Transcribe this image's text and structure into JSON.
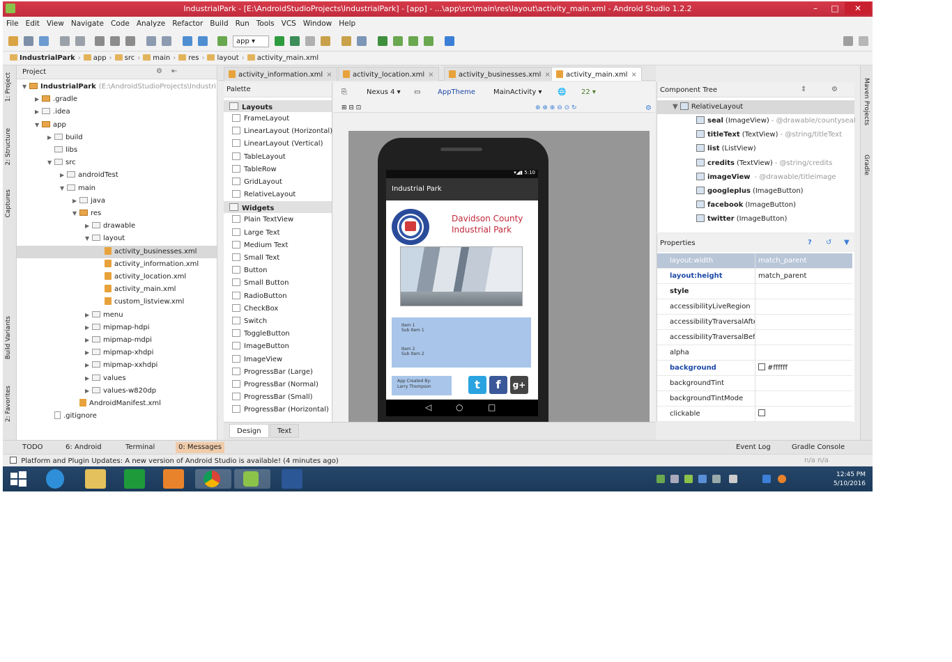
{
  "window": {
    "title": "IndustrialPark - [E:\\AndroidStudioProjects\\IndustrialPark] - [app] - ...\\app\\src\\main\\res\\layout\\activity_main.xml - Android Studio 1.2.2",
    "minimize": "–",
    "maximize": "□",
    "close": "✕"
  },
  "menu": [
    "File",
    "Edit",
    "View",
    "Navigate",
    "Code",
    "Analyze",
    "Refactor",
    "Build",
    "Run",
    "Tools",
    "VCS",
    "Window",
    "Help"
  ],
  "toolbar": {
    "run_config": "app ▾"
  },
  "breadcrumb": [
    "IndustrialPark",
    "app",
    "src",
    "main",
    "res",
    "layout",
    "activity_main.xml"
  ],
  "left_strip": [
    "1: Project",
    "2: Structure",
    "Captures",
    "Build Variants",
    "2: Favorites"
  ],
  "right_strip": [
    "Maven Projects",
    "Gradle"
  ],
  "project": {
    "header": "Project",
    "tree": [
      {
        "label": "IndustrialPark",
        "extra": "(E:\\AndroidStudioProjects\\Industri",
        "kind": "folder-mod",
        "depth": 0,
        "arrow": "▼"
      },
      {
        "label": ".gradle",
        "kind": "folder-mod",
        "depth": 1,
        "arrow": "▶"
      },
      {
        "label": ".idea",
        "kind": "folder",
        "depth": 1,
        "arrow": "▶"
      },
      {
        "label": "app",
        "kind": "folder-mod",
        "depth": 1,
        "arrow": "▼"
      },
      {
        "label": "build",
        "kind": "folder",
        "depth": 2,
        "arrow": "▶"
      },
      {
        "label": "libs",
        "kind": "folder",
        "depth": 2,
        "arrow": ""
      },
      {
        "label": "src",
        "kind": "folder",
        "depth": 2,
        "arrow": "▼"
      },
      {
        "label": "androidTest",
        "kind": "folder",
        "depth": 3,
        "arrow": "▶"
      },
      {
        "label": "main",
        "kind": "folder",
        "depth": 3,
        "arrow": "▼"
      },
      {
        "label": "java",
        "kind": "folder",
        "depth": 4,
        "arrow": "▶"
      },
      {
        "label": "res",
        "kind": "folder-mod",
        "depth": 4,
        "arrow": "▼"
      },
      {
        "label": "drawable",
        "kind": "folder",
        "depth": 5,
        "arrow": "▶"
      },
      {
        "label": "layout",
        "kind": "folder",
        "depth": 5,
        "arrow": "▼"
      },
      {
        "label": "activity_businesses.xml",
        "kind": "xml",
        "depth": 6,
        "arrow": "",
        "selected": true
      },
      {
        "label": "activity_information.xml",
        "kind": "xml",
        "depth": 6,
        "arrow": ""
      },
      {
        "label": "activity_location.xml",
        "kind": "xml",
        "depth": 6,
        "arrow": ""
      },
      {
        "label": "activity_main.xml",
        "kind": "xml",
        "depth": 6,
        "arrow": ""
      },
      {
        "label": "custom_listview.xml",
        "kind": "xml",
        "depth": 6,
        "arrow": ""
      },
      {
        "label": "menu",
        "kind": "folder",
        "depth": 5,
        "arrow": "▶"
      },
      {
        "label": "mipmap-hdpi",
        "kind": "folder",
        "depth": 5,
        "arrow": "▶"
      },
      {
        "label": "mipmap-mdpi",
        "kind": "folder",
        "depth": 5,
        "arrow": "▶"
      },
      {
        "label": "mipmap-xhdpi",
        "kind": "folder",
        "depth": 5,
        "arrow": "▶"
      },
      {
        "label": "mipmap-xxhdpi",
        "kind": "folder",
        "depth": 5,
        "arrow": "▶"
      },
      {
        "label": "values",
        "kind": "folder",
        "depth": 5,
        "arrow": "▶"
      },
      {
        "label": "values-w820dp",
        "kind": "folder",
        "depth": 5,
        "arrow": "▶"
      },
      {
        "label": "AndroidManifest.xml",
        "kind": "xml",
        "depth": 4,
        "arrow": ""
      },
      {
        "label": ".gitignore",
        "kind": "file",
        "depth": 2,
        "arrow": ""
      }
    ]
  },
  "editor_tabs": [
    {
      "label": "activity_information.xml",
      "active": false
    },
    {
      "label": "activity_location.xml",
      "active": false
    },
    {
      "label": "activity_businesses.xml",
      "active": false
    },
    {
      "label": "activity_main.xml",
      "active": true
    }
  ],
  "palette": {
    "header": "Palette",
    "groups": [
      {
        "name": "Layouts",
        "items": [
          "FrameLayout",
          "LinearLayout (Horizontal)",
          "LinearLayout (Vertical)",
          "TableLayout",
          "TableRow",
          "GridLayout",
          "RelativeLayout"
        ]
      },
      {
        "name": "Widgets",
        "items": [
          "Plain TextView",
          "Large Text",
          "Medium Text",
          "Small Text",
          "Button",
          "Small Button",
          "RadioButton",
          "CheckBox",
          "Switch",
          "ToggleButton",
          "ImageButton",
          "ImageView",
          "ProgressBar (Large)",
          "ProgressBar (Normal)",
          "ProgressBar (Small)",
          "ProgressBar (Horizontal)"
        ]
      }
    ]
  },
  "designer": {
    "device": "Nexus 4 ▾",
    "theme": "AppTheme",
    "activity": "MainActivity ▾",
    "api": "22 ▾"
  },
  "device_preview": {
    "status_time": "5:10",
    "app_title": "Industrial Park",
    "park_title": "Davidson County Industrial Park",
    "list_items": [
      {
        "title": "Item 1",
        "sub": "Sub Item 1"
      },
      {
        "title": "Item 2",
        "sub": "Sub Item 2"
      }
    ],
    "credits_line1": "App Created By:",
    "credits_line2": "Larry Thompson",
    "twitter_glyph": "t",
    "facebook_glyph": "f",
    "gplus_glyph": "g+",
    "nav_back": "◁",
    "nav_home": "○",
    "nav_recent": "□"
  },
  "mode_tabs": [
    {
      "label": "Design",
      "active": true
    },
    {
      "label": "Text",
      "active": false
    }
  ],
  "component_tree": {
    "header": "Component Tree",
    "root": "RelativeLayout",
    "items": [
      {
        "name": "seal",
        "type": "(ImageView)",
        "attr": "- @drawable/countyseal"
      },
      {
        "name": "titleText",
        "type": "(TextView)",
        "attr": "- @string/titleText"
      },
      {
        "name": "list",
        "type": "(ListView)",
        "attr": ""
      },
      {
        "name": "credits",
        "type": "(TextView)",
        "attr": "- @string/credits"
      },
      {
        "name": "imageView",
        "type": "",
        "attr": "- @drawable/titleimage"
      },
      {
        "name": "googleplus",
        "type": "(ImageButton)",
        "attr": ""
      },
      {
        "name": "facebook",
        "type": "(ImageButton)",
        "attr": ""
      },
      {
        "name": "twitter",
        "type": "(ImageButton)",
        "attr": ""
      }
    ]
  },
  "properties": {
    "header": "Properties",
    "rows": [
      {
        "name": "layout:width",
        "value": "match_parent",
        "style": "selected"
      },
      {
        "name": "layout:height",
        "value": "match_parent",
        "style": "hl"
      },
      {
        "name": "style",
        "value": "",
        "style": "bold"
      },
      {
        "name": "accessibilityLiveRegion",
        "value": "",
        "style": ""
      },
      {
        "name": "accessibilityTraversalAfte",
        "value": "",
        "style": ""
      },
      {
        "name": "accessibilityTraversalBefc",
        "value": "",
        "style": ""
      },
      {
        "name": "alpha",
        "value": "",
        "style": ""
      },
      {
        "name": "background",
        "value": "#ffffff",
        "style": "hl",
        "checkbox": true
      },
      {
        "name": "backgroundTint",
        "value": "",
        "style": ""
      },
      {
        "name": "backgroundTintMode",
        "value": "",
        "style": ""
      },
      {
        "name": "clickable",
        "value": "",
        "style": "",
        "checkbox": true
      }
    ]
  },
  "bottom_tabs": {
    "todo": "TODO",
    "android": "6: Android",
    "terminal": "Terminal",
    "messages": "0: Messages",
    "event_log": "Event Log",
    "gradle_console": "Gradle Console"
  },
  "status_message": "Platform and Plugin Updates: A new version of Android Studio is available! (4 minutes ago)",
  "status_right": "n/a   n/a",
  "taskbar": {
    "time": "12:45 PM",
    "date": "5/10/2016"
  },
  "colors": {
    "titlebar": "#c22c3e",
    "accent_blue": "#1c48a8",
    "list_bg": "#a9c6ea",
    "park_title": "#c0283a",
    "twitter": "#2aa3e0",
    "facebook": "#3b5998",
    "gplus": "#444444"
  }
}
